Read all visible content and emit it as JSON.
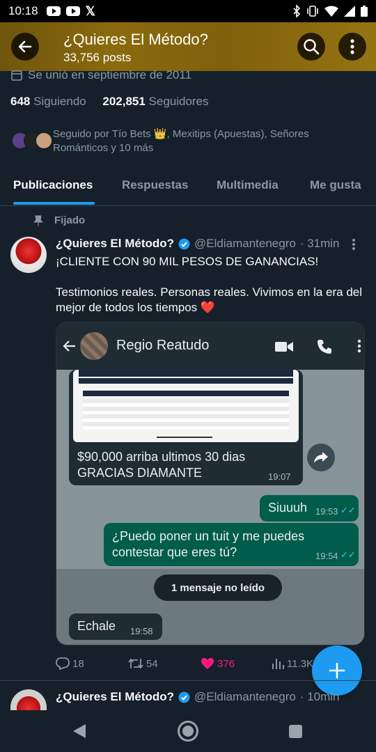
{
  "status": {
    "time": "10:18"
  },
  "header": {
    "title": "¿Quieres El Método?",
    "posts": "33,756 posts"
  },
  "profile": {
    "joined": "Se unió en septiembre de 2011",
    "following_count": "648",
    "following_label": "Siguiendo",
    "followers_count": "202,851",
    "followers_label": "Seguidores",
    "followed_by": "Seguido por Tío Bets 👑, Mexitips (Apuestas), Señores Románticos y 10 más"
  },
  "tabs": [
    {
      "label": "Publicaciones"
    },
    {
      "label": "Respuestas"
    },
    {
      "label": "Multimedia"
    },
    {
      "label": "Me gusta"
    }
  ],
  "pinned_label": "Fijado",
  "tweet": {
    "name": "¿Quieres El Método?",
    "handle": "@Eldiamantenegro",
    "time": "· 31min",
    "line1": "¡CLIENTE CON 90 MIL PESOS DE GANANCIAS!",
    "line2": "Testimonios reales. Personas reales. Vivimos en la era del mejor de todos los tiempos ❤️",
    "replies": "18",
    "retweets": "54",
    "likes": "376",
    "views": "11.3K"
  },
  "whatsapp": {
    "contact": "Regio Reatudo",
    "msg1_line1": "$90,000 arriba ultimos 30 dias",
    "msg1_line2": "GRACIAS DIAMANTE",
    "msg1_time": "19:07",
    "msg2": "Siuuuh",
    "msg2_time": "19:53",
    "msg3_line1": "¿Puedo poner un tuit y me puedes",
    "msg3_line2": "contestar que eres tú?",
    "msg3_time": "19:54",
    "unread": "1 mensaje no leído",
    "msg4": "Echale",
    "msg4_time": "19:58"
  },
  "tweet2": {
    "name": "¿Quieres El Método?",
    "handle": "@Eldiamantenegro",
    "time": "· 10min"
  },
  "colors": {
    "accent": "#1d9bf0",
    "like": "#f91880",
    "background": "#15202b",
    "wa_out": "#005c4b"
  }
}
